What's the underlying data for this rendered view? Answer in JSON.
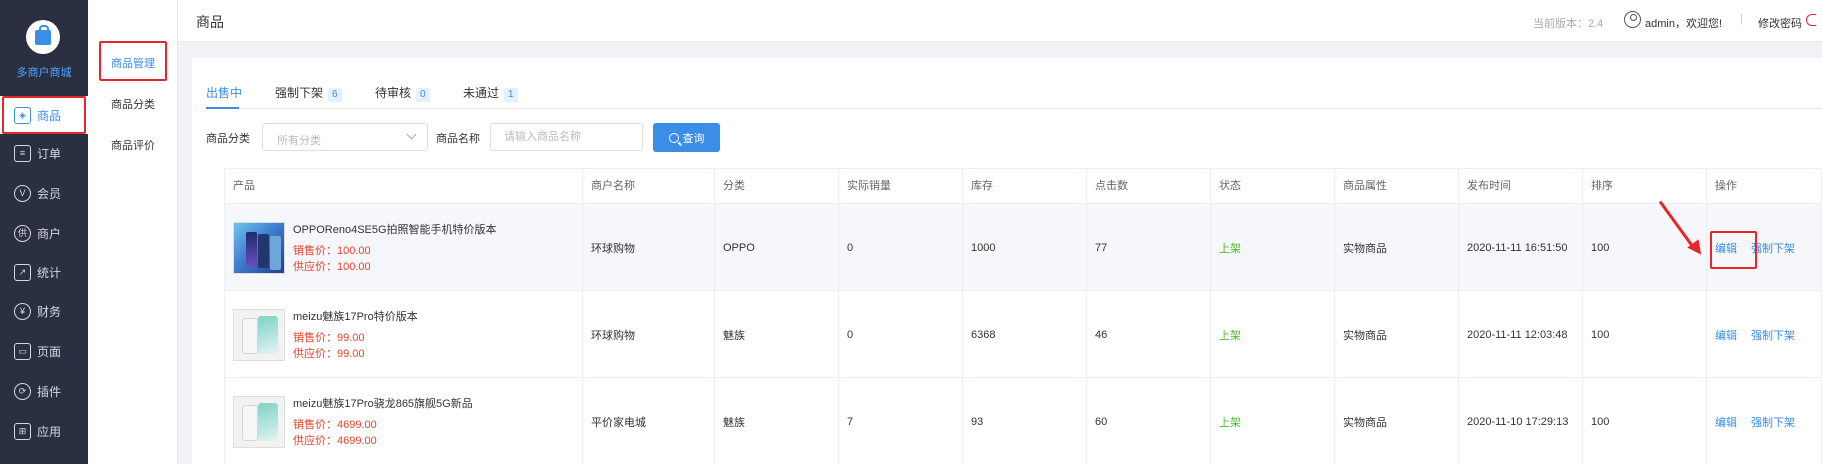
{
  "app": {
    "name": "多商户商城"
  },
  "sidebar": {
    "items": [
      {
        "label": "商品",
        "icon": "layers-icon",
        "glyph": "◈",
        "active": true
      },
      {
        "label": "订单",
        "icon": "clipboard-icon",
        "glyph": "≡",
        "active": false
      },
      {
        "label": "会员",
        "icon": "vip-icon",
        "glyph": "V",
        "active": false
      },
      {
        "label": "商户",
        "icon": "merchant-icon",
        "glyph": "供",
        "active": false
      },
      {
        "label": "统计",
        "icon": "chart-icon",
        "glyph": "↗",
        "active": false
      },
      {
        "label": "财务",
        "icon": "yen-icon",
        "glyph": "¥",
        "active": false
      },
      {
        "label": "页面",
        "icon": "page-icon",
        "glyph": "▭",
        "active": false
      },
      {
        "label": "插件",
        "icon": "plugin-icon",
        "glyph": "⟳",
        "active": false
      },
      {
        "label": "应用",
        "icon": "apps-icon",
        "glyph": "⊞",
        "active": false
      }
    ]
  },
  "subnav": {
    "items": [
      {
        "label": "商品管理",
        "active": true
      },
      {
        "label": "商品分类",
        "active": false
      },
      {
        "label": "商品评价",
        "active": false
      }
    ]
  },
  "header": {
    "title": "商品",
    "version": "当前版本：2.4",
    "welcome": "admin，欢迎您!",
    "separator": "|",
    "change_password": "修改密码"
  },
  "tabs": [
    {
      "label": "出售中",
      "count": "",
      "active": true
    },
    {
      "label": "强制下架",
      "count": "6",
      "active": false
    },
    {
      "label": "待审核",
      "count": "0",
      "active": false
    },
    {
      "label": "未通过",
      "count": "1",
      "active": false
    }
  ],
  "filters": {
    "category_label": "商品分类",
    "category_value": "所有分类",
    "name_label": "商品名称",
    "name_placeholder": "请输入商品名称",
    "query_label": "查询"
  },
  "table": {
    "columns": [
      "产品",
      "商户名称",
      "分类",
      "实际销量",
      "库存",
      "点击数",
      "状态",
      "商品属性",
      "发布时间",
      "排序",
      "操作"
    ],
    "rows": [
      {
        "name": "OPPOReno4SE5G拍照智能手机特价版本",
        "sale_price": "销售价：100.00",
        "supply_price": "供应价：100.00",
        "merchant": "环球购物",
        "category": "OPPO",
        "sales": "0",
        "stock": "1000",
        "clicks": "77",
        "status": "上架",
        "attribute": "实物商品",
        "publish_time": "2020-11-11 16:51:50",
        "sort": "100",
        "edit": "编辑",
        "force_off": "强制下架"
      },
      {
        "name": "meizu魅族17Pro特价版本",
        "sale_price": "销售价：99.00",
        "supply_price": "供应价：99.00",
        "merchant": "环球购物",
        "category": "魅族",
        "sales": "0",
        "stock": "6368",
        "clicks": "46",
        "status": "上架",
        "attribute": "实物商品",
        "publish_time": "2020-11-11 12:03:48",
        "sort": "100",
        "edit": "编辑",
        "force_off": "强制下架"
      },
      {
        "name": "meizu魅族17Pro骁龙865旗舰5G新品",
        "sale_price": "销售价：4699.00",
        "supply_price": "供应价：4699.00",
        "merchant": "平价家电城",
        "category": "魅族",
        "sales": "7",
        "stock": "93",
        "clicks": "60",
        "status": "上架",
        "attribute": "实物商品",
        "publish_time": "2020-11-10 17:29:13",
        "sort": "100",
        "edit": "编辑",
        "force_off": "强制下架"
      }
    ]
  },
  "colors": {
    "sidebar_bg": "#2b2f42",
    "accent": "#3a8ee6",
    "price": "#e8442e",
    "status_on": "#4dbd2e",
    "highlight": "#e6262b"
  }
}
